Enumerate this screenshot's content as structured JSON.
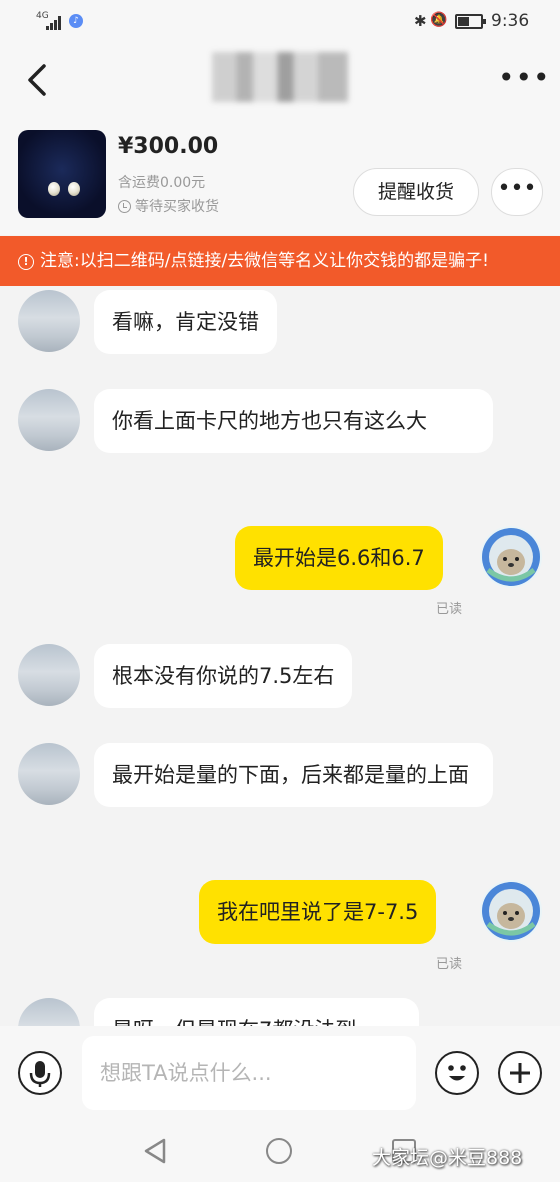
{
  "status_bar": {
    "network": "4G",
    "time": "9:36",
    "battery_level": 0.5
  },
  "header": {
    "title": ""
  },
  "product": {
    "price": "¥300.00",
    "shipping": "含运费0.00元",
    "status": "等待买家收货",
    "remind_button": "提醒收货",
    "more_button": "•••"
  },
  "warning": {
    "text": "注意:以扫二维码/点链接/去微信等名义让你交钱的都是骗子!"
  },
  "messages": [
    {
      "side": "left",
      "text": "看嘛，肯定没错"
    },
    {
      "side": "left",
      "text": "你看上面卡尺的地方也只有这么大"
    },
    {
      "side": "right",
      "text": "最开始是6.6和6.7",
      "read": "已读"
    },
    {
      "side": "left",
      "text": "根本没有你说的7.5左右"
    },
    {
      "side": "left",
      "text": "最开始是量的下面，后来都是量的上面"
    },
    {
      "side": "right",
      "text": "我在吧里说了是7-7.5",
      "read": "已读"
    },
    {
      "side": "left",
      "text": "是呀，但是现在7都没法到"
    }
  ],
  "input": {
    "placeholder": "想跟TA说点什么..."
  },
  "watermark": "大家坛@米豆888",
  "icons": {
    "back": "back-arrow-icon",
    "more": "more-dots-icon",
    "voice": "microphone-icon",
    "emoji": "emoji-icon",
    "add": "plus-icon"
  },
  "colors": {
    "accent_yellow": "#ffe100",
    "warning_orange": "#f25a2a"
  }
}
